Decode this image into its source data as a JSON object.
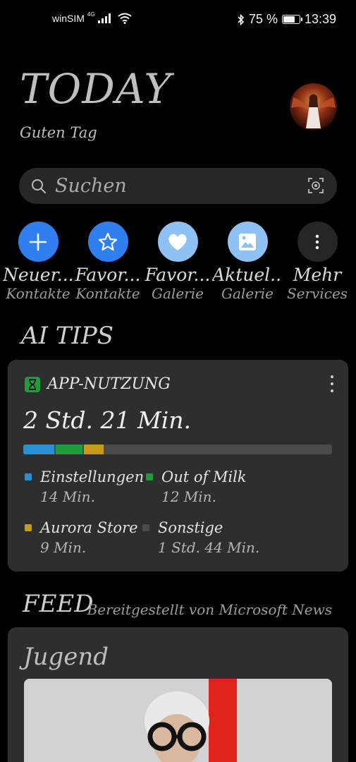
{
  "status_bar": {
    "carrier": "winSIM",
    "network": "4G",
    "battery_text": "75 %",
    "battery_level": 0.75,
    "time": "13:39"
  },
  "header": {
    "title": "TODAY",
    "greeting": "Guten Tag"
  },
  "search": {
    "placeholder": "Suchen"
  },
  "quick_actions": [
    {
      "title": "Neuer...",
      "subtitle": "Kontakte",
      "icon": "plus-icon",
      "color": "#2f7ff0"
    },
    {
      "title": "Favor...",
      "subtitle": "Kontakte",
      "icon": "star-icon",
      "color": "#2f7ff0"
    },
    {
      "title": "Favor...",
      "subtitle": "Galerie",
      "icon": "heart-icon",
      "color": "#8ec2f5"
    },
    {
      "title": "Aktuel...",
      "subtitle": "Galerie",
      "icon": "image-icon",
      "color": "#8ec2f5"
    },
    {
      "title": "Mehr",
      "subtitle": "Services",
      "icon": "more-icon",
      "color": "#262626"
    }
  ],
  "ai_tips": {
    "section_title": "AI TIPS",
    "card": {
      "label": "APP-NUTZUNG",
      "total": "2 Std. 21 Min.",
      "usage": [
        {
          "name": "Einstellungen",
          "value": "14 Min.",
          "minutes": 14,
          "color": "#2b8fd6"
        },
        {
          "name": "Out of Milk",
          "value": "12 Min.",
          "minutes": 12,
          "color": "#1f9c3b"
        },
        {
          "name": "Aurora Store",
          "value": "9 Min.",
          "minutes": 9,
          "color": "#c99a1a"
        },
        {
          "name": "Sonstige",
          "value": "1 Std. 44 Min.",
          "minutes": 104,
          "color": "#4a4a4a"
        }
      ]
    }
  },
  "feed": {
    "section_title": "FEED",
    "provider": "Bereitgestellt von Microsoft News",
    "category": "Jugend"
  }
}
